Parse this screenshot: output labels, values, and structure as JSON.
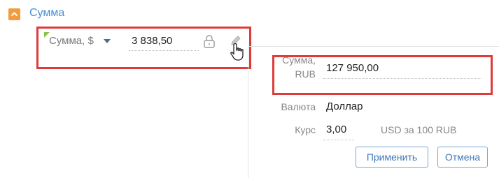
{
  "section": {
    "title": "Сумма"
  },
  "amount_field": {
    "label": "Сумма, $",
    "value": "3 838,50"
  },
  "popup": {
    "rub_label_line1": "Сумма,",
    "rub_label_line2": "RUB",
    "rub_value": "127 950,00",
    "currency_label": "Валюта",
    "currency_value": "Доллар",
    "rate_label": "Курс",
    "rate_value": "3,00",
    "rate_unit": "USD за 100 RUB",
    "apply_label": "Применить",
    "cancel_label": "Отмена"
  },
  "colors": {
    "accent": "#4a8cd1",
    "collapse_button": "#f39c3c",
    "highlight": "#e03b3b",
    "required_marker": "#8bc34a"
  }
}
